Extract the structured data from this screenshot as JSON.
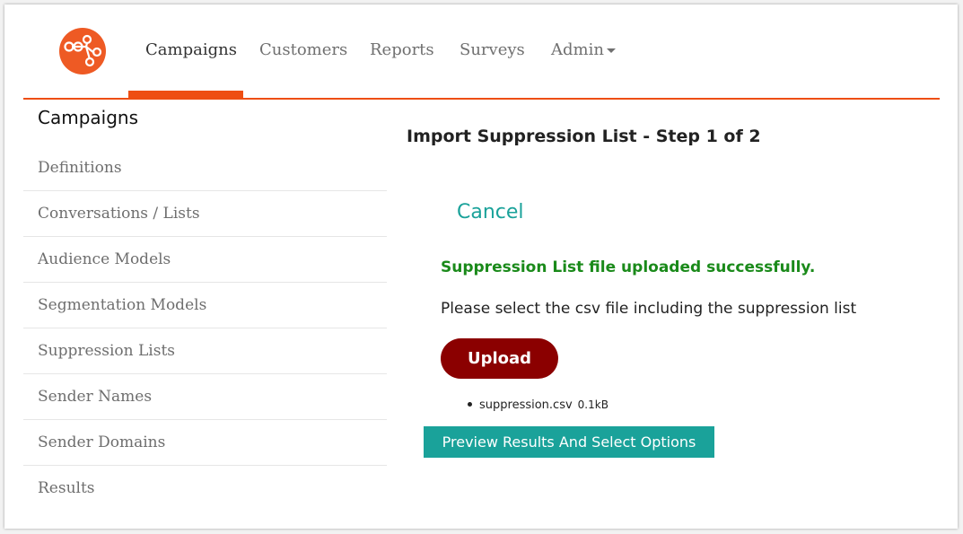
{
  "brand": {
    "logo_icon": "network-nodes-icon",
    "logo_color": "#ee5a24"
  },
  "nav": {
    "items": [
      {
        "label": "Campaigns",
        "active": true
      },
      {
        "label": "Customers",
        "active": false
      },
      {
        "label": "Reports",
        "active": false
      },
      {
        "label": "Surveys",
        "active": false
      },
      {
        "label": "Admin",
        "active": false,
        "dropdown": true
      }
    ],
    "accent": "#ee4e12"
  },
  "sidebar": {
    "title": "Campaigns",
    "items": [
      {
        "label": "Definitions"
      },
      {
        "label": "Conversations / Lists"
      },
      {
        "label": "Audience Models"
      },
      {
        "label": "Segmentation Models"
      },
      {
        "label": "Suppression Lists"
      },
      {
        "label": "Sender Names"
      },
      {
        "label": "Sender Domains"
      },
      {
        "label": "Results"
      }
    ]
  },
  "main": {
    "title": "Import Suppression List - Step 1 of 2",
    "cancel_label": "Cancel",
    "success_message": "Suppression List file uploaded successfully.",
    "instruction": "Please select the csv file including the suppression list",
    "upload_label": "Upload",
    "file": {
      "name": "suppression.csv",
      "size": "0.1kB"
    },
    "preview_label": "Preview Results And Select Options"
  },
  "colors": {
    "teal": "#1aa29a",
    "success": "#1a8a1a",
    "upload_button": "#8b0000"
  }
}
